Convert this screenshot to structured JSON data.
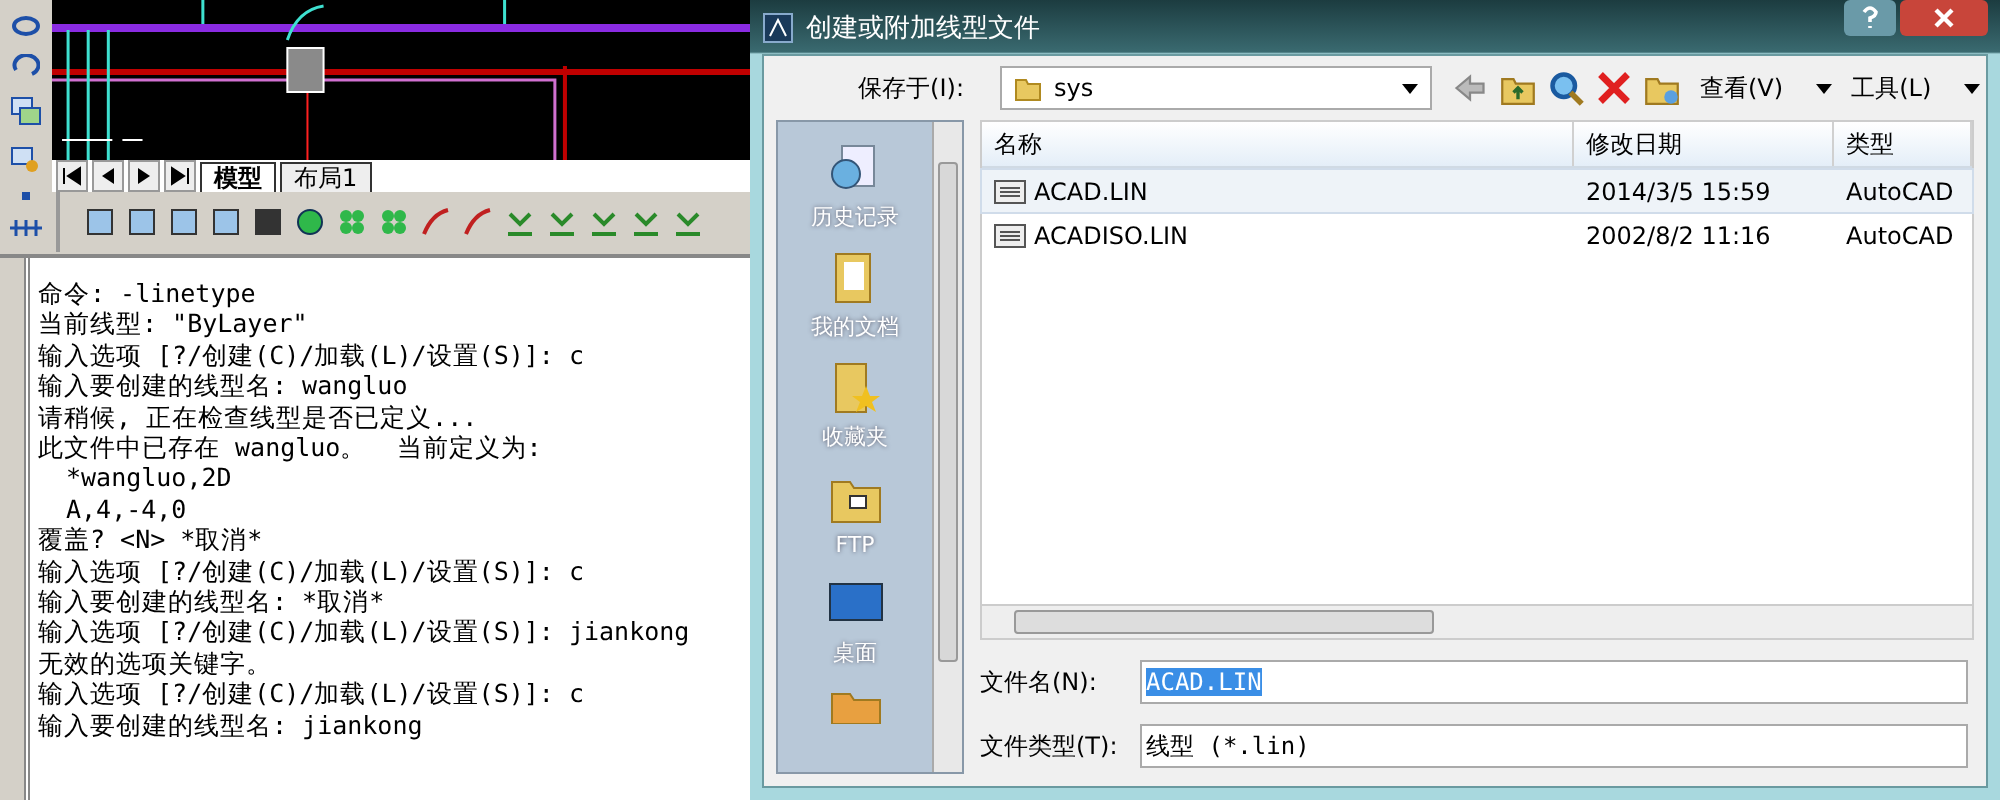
{
  "cad": {
    "tabs": [
      {
        "label": "模型",
        "selected": true
      },
      {
        "label": "布局1",
        "selected": false
      }
    ],
    "command_lines": [
      {
        "text": "命令: -linetype",
        "kind": "line"
      },
      {
        "text": "当前线型: \"ByLayer\"",
        "kind": "line"
      },
      {
        "text": "输入选项 [?/创建(C)/加载(L)/设置(S)]: c",
        "kind": "line"
      },
      {
        "text": "输入要创建的线型名: wangluo",
        "kind": "line"
      },
      {
        "text": "请稍候, 正在检查线型是否已定义...",
        "kind": "line"
      },
      {
        "text": "此文件中已存在 wangluo。  当前定义为:",
        "kind": "line"
      },
      {
        "text": "*wangluo,2D",
        "kind": "definition"
      },
      {
        "text": "A,4,-4,0",
        "kind": "definition"
      },
      {
        "text": "覆盖? <N> *取消*",
        "kind": "line"
      },
      {
        "text": "输入选项 [?/创建(C)/加载(L)/设置(S)]: c",
        "kind": "line"
      },
      {
        "text": "输入要创建的线型名: *取消*",
        "kind": "line"
      },
      {
        "text": "输入选项 [?/创建(C)/加载(L)/设置(S)]: jiankong",
        "kind": "line"
      },
      {
        "text": "无效的选项关键字。",
        "kind": "line"
      },
      {
        "text": "输入选项 [?/创建(C)/加载(L)/设置(S)]: c",
        "kind": "line"
      },
      {
        "text": "输入要创建的线型名: jiankong",
        "kind": "line"
      }
    ]
  },
  "dialog": {
    "title": "创建或附加线型文件",
    "save_in_label": "保存于(I):",
    "folder": "sys",
    "view_label": "查看(V)",
    "tools_label": "工具(L)",
    "places": [
      {
        "label": "历史记录",
        "kind": "history"
      },
      {
        "label": "我的文档",
        "kind": "documents"
      },
      {
        "label": "收藏夹",
        "kind": "favorites"
      },
      {
        "label": "FTP",
        "kind": "ftp"
      },
      {
        "label": "桌面",
        "kind": "desktop"
      }
    ],
    "columns": [
      "名称",
      "修改日期",
      "类型"
    ],
    "files": [
      {
        "name": "ACAD.LIN",
        "date": "2014/3/5 15:59",
        "type": "AutoCAD",
        "selected": true
      },
      {
        "name": "ACADISO.LIN",
        "date": "2002/8/2 11:16",
        "type": "AutoCAD",
        "selected": false
      }
    ],
    "filename_label": "文件名(N):",
    "filename": "ACAD.LIN",
    "filetype_label": "文件类型(T):",
    "filetype": "线型 (*.lin)"
  }
}
